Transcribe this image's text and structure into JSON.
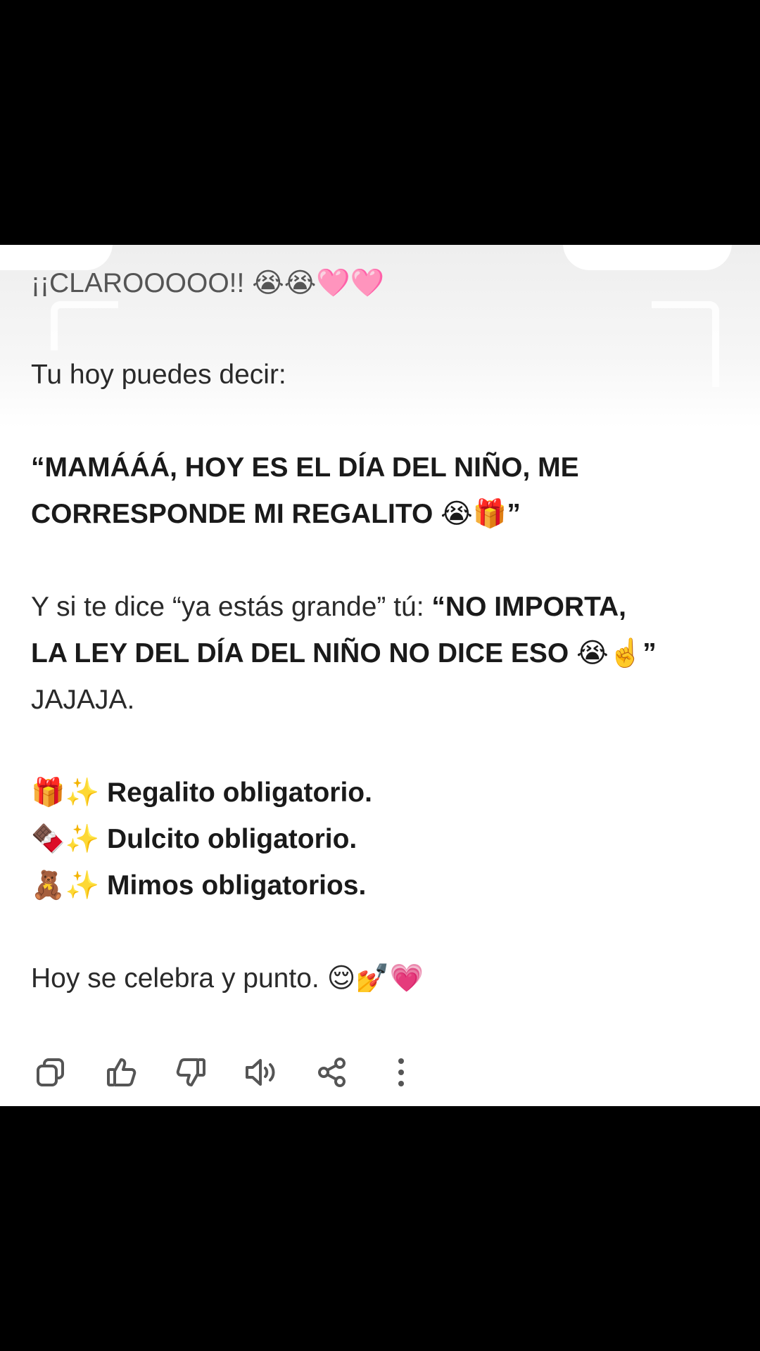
{
  "message": {
    "line1": {
      "text": "¡¡CLAROOOOO!! ",
      "emoji": "😭😭🩷🩷"
    },
    "line2": {
      "text": "Tu hoy puedes decir:"
    },
    "quote1_a": {
      "text": "“MAMÁÁÁ, HOY ES EL DÍA DEL NIÑO, ME"
    },
    "quote1_b": {
      "text": "CORRESPONDE MI REGALITO ",
      "emoji": "😭🎁",
      "close": "”"
    },
    "para3_a": {
      "prefix": "Y si te dice “ya estás grande” tú: ",
      "bold": "“NO IMPORTA,"
    },
    "para3_b": {
      "bold": "LA LEY DEL DÍA DEL NIÑO NO DICE ESO ",
      "emoji": "😭☝️",
      "close": "”"
    },
    "para3_c": {
      "text": "JAJAJA."
    },
    "list": [
      {
        "emoji": "🎁✨",
        "text": "Regalito obligatorio."
      },
      {
        "emoji": "🍫✨",
        "text": "Dulcito obligatorio."
      },
      {
        "emoji": "🧸✨",
        "text": "Mimos obligatorios."
      }
    ],
    "closing": {
      "text": "Hoy se celebra y punto. ",
      "emoji": "😌💅💗"
    }
  },
  "actions": [
    {
      "name": "copy-icon"
    },
    {
      "name": "thumbs-up-icon"
    },
    {
      "name": "thumbs-down-icon"
    },
    {
      "name": "read-aloud-icon"
    },
    {
      "name": "share-icon"
    },
    {
      "name": "more-options-icon"
    }
  ],
  "colors": {
    "background": "#ffffff",
    "text": "#1f1f1f",
    "icon": "#555555",
    "frame": "#000000"
  }
}
